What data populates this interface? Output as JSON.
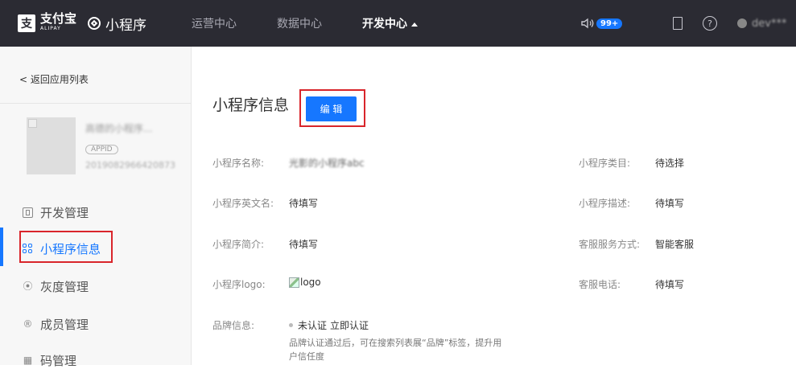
{
  "topbar": {
    "brand": {
      "logo_glyph": "支",
      "name": "支付宝",
      "sub": "ALIPAY",
      "product": "小程序"
    },
    "nav": [
      {
        "label": "运营中心",
        "active": false
      },
      {
        "label": "数据中心",
        "active": false
      },
      {
        "label": "开发中心",
        "active": true
      }
    ],
    "notification_count": "99+",
    "user_name": "dev***",
    "help_glyph": "?",
    "colors": {
      "bar": "#2b2b33",
      "accent": "#1677ff"
    }
  },
  "sidebar": {
    "back_label": "< 返回应用列表",
    "app": {
      "name": "高德的小程序...",
      "appid_tag": "APPID",
      "appid": "2019082966420873"
    },
    "items": [
      {
        "label": "开发管理",
        "icon": "code-box-icon"
      },
      {
        "label": "小程序信息",
        "icon": "grid-apps-icon",
        "active": true
      },
      {
        "label": "灰度管理",
        "icon": "broadcast-icon"
      },
      {
        "label": "成员管理",
        "icon": "member-icon"
      },
      {
        "label": "码管理",
        "icon": "qrcode-icon"
      }
    ],
    "icon_glyphs": {
      "broadcast": "⦿",
      "member": "®",
      "qrcode": "▦"
    }
  },
  "main": {
    "title": "小程序信息",
    "edit_label": "编 辑",
    "fields": {
      "name": {
        "label": "小程序名称:",
        "value": "光影的小程序abc"
      },
      "category": {
        "label": "小程序类目:",
        "value": "待选择"
      },
      "en_name": {
        "label": "小程序英文名:",
        "value": "待填写"
      },
      "desc": {
        "label": "小程序描述:",
        "value": "待填写"
      },
      "intro": {
        "label": "小程序简介:",
        "value": "待填写"
      },
      "service": {
        "label": "客服服务方式:",
        "value": "智能客服"
      },
      "logo": {
        "label": "小程序logo:",
        "value": "logo"
      },
      "phone": {
        "label": "客服电话:",
        "value": "待填写"
      },
      "brand": {
        "label": "品牌信息:",
        "status": "未认证",
        "link": "立即认证",
        "note": "品牌认证通过后，可在搜索列表展“品牌”标签，提升用户信任度"
      }
    }
  }
}
